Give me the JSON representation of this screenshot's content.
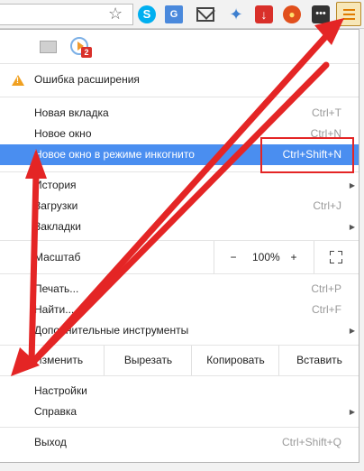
{
  "menu": {
    "extension_error": "Ошибка расширения",
    "items_group1": [
      {
        "label": "Новая вкладка",
        "shortcut": "Ctrl+T"
      },
      {
        "label": "Новое окно",
        "shortcut": "Ctrl+N"
      },
      {
        "label": "Новое окно в режиме инкогнито",
        "shortcut": "Ctrl+Shift+N"
      }
    ],
    "items_group2": [
      {
        "label": "История",
        "shortcut": ""
      },
      {
        "label": "Загрузки",
        "shortcut": "Ctrl+J"
      },
      {
        "label": "Закладки",
        "shortcut": ""
      }
    ],
    "zoom": {
      "label": "Масштаб",
      "minus": "−",
      "value": "100%",
      "plus": "+"
    },
    "items_group3": [
      {
        "label": "Печать...",
        "shortcut": "Ctrl+P"
      },
      {
        "label": "Найти...",
        "shortcut": "Ctrl+F"
      },
      {
        "label": "Дополнительные инструменты",
        "shortcut": ""
      }
    ],
    "edit": {
      "label": "Изменить",
      "cut": "Вырезать",
      "copy": "Копировать",
      "paste": "Вставить"
    },
    "settings": "Настройки",
    "help": "Справка",
    "exit": {
      "label": "Выход",
      "shortcut": "Ctrl+Shift+Q"
    }
  },
  "toolbar": {
    "skype_glyph": "S",
    "translate_glyph": "G",
    "download_glyph": "↓",
    "dots_glyph": "•••"
  },
  "colors": {
    "highlight": "#4a8ef0",
    "arrow": "#e42525",
    "warning": "#f0a020"
  }
}
